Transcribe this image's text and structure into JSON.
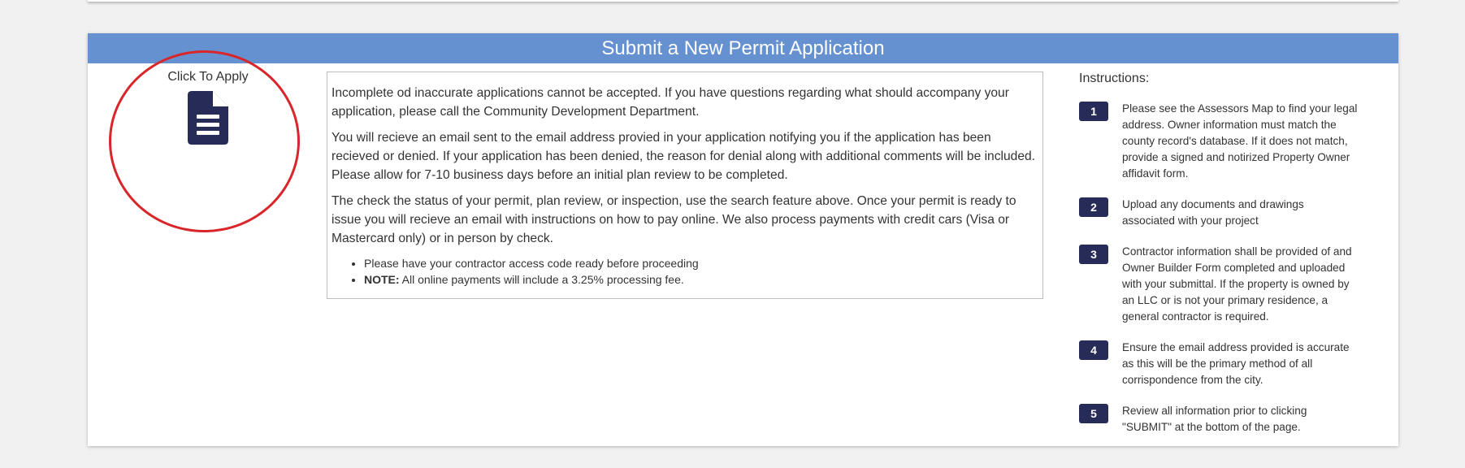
{
  "panel": {
    "title": "Submit a New Permit Application"
  },
  "apply": {
    "label": "Click To Apply",
    "icon": "document-icon"
  },
  "info": {
    "paragraphs": [
      "Incomplete od inaccurate applications cannot be accepted. If you have questions regarding what should accompany your application, please call the Community Development Department.",
      "You will recieve an email sent to the email address provied in your application notifying you if the application has been recieved or denied. If your application has been denied, the reason for denial along with additional comments will be included. Please allow for 7-10 business days before an initial plan review to be completed.",
      "The check the status of your permit, plan review, or inspection, use the search feature above. Once your permit is ready to issue you will recieve an email with instructions on how to pay online. We also process payments with credit cars (Visa or Mastercard only) or in person by check."
    ],
    "bullet_1": "Please have your contractor access code ready before proceeding",
    "bullet_2_strong": "NOTE:",
    "bullet_2_text": " All online payments will include a 3.25% processing fee."
  },
  "instructions": {
    "title": "Instructions:",
    "steps": [
      {
        "num": "1",
        "text": "Please see the Assessors Map to find your legal address. Owner information must match the county record's database. If it does not match, provide a signed and notirized Property Owner affidavit form."
      },
      {
        "num": "2",
        "text": "Upload any documents and drawings associated with your project"
      },
      {
        "num": "3",
        "text": "Contractor information shall be provided of and Owner Builder Form completed and uploaded with your submittal. If the property is owned by an LLC or is not your primary residence, a general contractor is required."
      },
      {
        "num": "4",
        "text": "Ensure the email address provided is accurate as this will be the primary method of all corrispondence from the city."
      },
      {
        "num": "5",
        "text": "Review all information prior to clicking \"SUBMIT\" at the bottom of the page."
      }
    ]
  },
  "colors": {
    "header": "#6591d0",
    "accent": "#262b58",
    "highlight_circle": "#d8262b"
  }
}
